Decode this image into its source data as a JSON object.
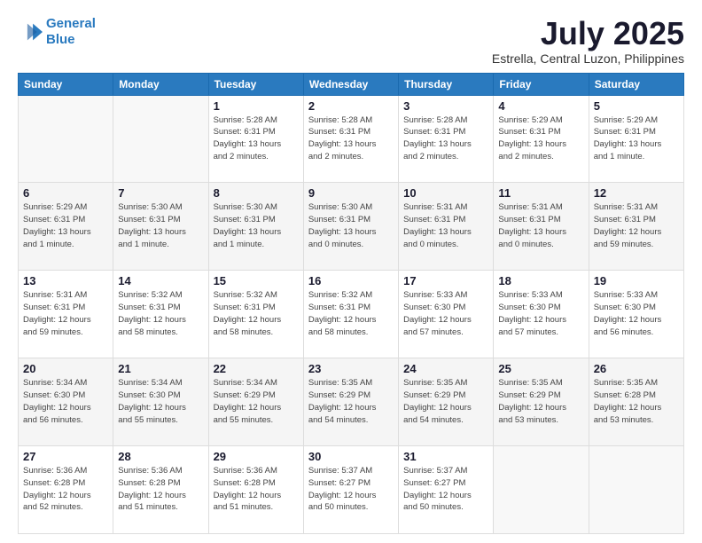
{
  "logo": {
    "line1": "General",
    "line2": "Blue"
  },
  "title": "July 2025",
  "subtitle": "Estrella, Central Luzon, Philippines",
  "weekdays": [
    "Sunday",
    "Monday",
    "Tuesday",
    "Wednesday",
    "Thursday",
    "Friday",
    "Saturday"
  ],
  "weeks": [
    [
      {
        "day": "",
        "info": ""
      },
      {
        "day": "",
        "info": ""
      },
      {
        "day": "1",
        "info": "Sunrise: 5:28 AM\nSunset: 6:31 PM\nDaylight: 13 hours\nand 2 minutes."
      },
      {
        "day": "2",
        "info": "Sunrise: 5:28 AM\nSunset: 6:31 PM\nDaylight: 13 hours\nand 2 minutes."
      },
      {
        "day": "3",
        "info": "Sunrise: 5:28 AM\nSunset: 6:31 PM\nDaylight: 13 hours\nand 2 minutes."
      },
      {
        "day": "4",
        "info": "Sunrise: 5:29 AM\nSunset: 6:31 PM\nDaylight: 13 hours\nand 2 minutes."
      },
      {
        "day": "5",
        "info": "Sunrise: 5:29 AM\nSunset: 6:31 PM\nDaylight: 13 hours\nand 1 minute."
      }
    ],
    [
      {
        "day": "6",
        "info": "Sunrise: 5:29 AM\nSunset: 6:31 PM\nDaylight: 13 hours\nand 1 minute."
      },
      {
        "day": "7",
        "info": "Sunrise: 5:30 AM\nSunset: 6:31 PM\nDaylight: 13 hours\nand 1 minute."
      },
      {
        "day": "8",
        "info": "Sunrise: 5:30 AM\nSunset: 6:31 PM\nDaylight: 13 hours\nand 1 minute."
      },
      {
        "day": "9",
        "info": "Sunrise: 5:30 AM\nSunset: 6:31 PM\nDaylight: 13 hours\nand 0 minutes."
      },
      {
        "day": "10",
        "info": "Sunrise: 5:31 AM\nSunset: 6:31 PM\nDaylight: 13 hours\nand 0 minutes."
      },
      {
        "day": "11",
        "info": "Sunrise: 5:31 AM\nSunset: 6:31 PM\nDaylight: 13 hours\nand 0 minutes."
      },
      {
        "day": "12",
        "info": "Sunrise: 5:31 AM\nSunset: 6:31 PM\nDaylight: 12 hours\nand 59 minutes."
      }
    ],
    [
      {
        "day": "13",
        "info": "Sunrise: 5:31 AM\nSunset: 6:31 PM\nDaylight: 12 hours\nand 59 minutes."
      },
      {
        "day": "14",
        "info": "Sunrise: 5:32 AM\nSunset: 6:31 PM\nDaylight: 12 hours\nand 58 minutes."
      },
      {
        "day": "15",
        "info": "Sunrise: 5:32 AM\nSunset: 6:31 PM\nDaylight: 12 hours\nand 58 minutes."
      },
      {
        "day": "16",
        "info": "Sunrise: 5:32 AM\nSunset: 6:31 PM\nDaylight: 12 hours\nand 58 minutes."
      },
      {
        "day": "17",
        "info": "Sunrise: 5:33 AM\nSunset: 6:30 PM\nDaylight: 12 hours\nand 57 minutes."
      },
      {
        "day": "18",
        "info": "Sunrise: 5:33 AM\nSunset: 6:30 PM\nDaylight: 12 hours\nand 57 minutes."
      },
      {
        "day": "19",
        "info": "Sunrise: 5:33 AM\nSunset: 6:30 PM\nDaylight: 12 hours\nand 56 minutes."
      }
    ],
    [
      {
        "day": "20",
        "info": "Sunrise: 5:34 AM\nSunset: 6:30 PM\nDaylight: 12 hours\nand 56 minutes."
      },
      {
        "day": "21",
        "info": "Sunrise: 5:34 AM\nSunset: 6:30 PM\nDaylight: 12 hours\nand 55 minutes."
      },
      {
        "day": "22",
        "info": "Sunrise: 5:34 AM\nSunset: 6:29 PM\nDaylight: 12 hours\nand 55 minutes."
      },
      {
        "day": "23",
        "info": "Sunrise: 5:35 AM\nSunset: 6:29 PM\nDaylight: 12 hours\nand 54 minutes."
      },
      {
        "day": "24",
        "info": "Sunrise: 5:35 AM\nSunset: 6:29 PM\nDaylight: 12 hours\nand 54 minutes."
      },
      {
        "day": "25",
        "info": "Sunrise: 5:35 AM\nSunset: 6:29 PM\nDaylight: 12 hours\nand 53 minutes."
      },
      {
        "day": "26",
        "info": "Sunrise: 5:35 AM\nSunset: 6:28 PM\nDaylight: 12 hours\nand 53 minutes."
      }
    ],
    [
      {
        "day": "27",
        "info": "Sunrise: 5:36 AM\nSunset: 6:28 PM\nDaylight: 12 hours\nand 52 minutes."
      },
      {
        "day": "28",
        "info": "Sunrise: 5:36 AM\nSunset: 6:28 PM\nDaylight: 12 hours\nand 51 minutes."
      },
      {
        "day": "29",
        "info": "Sunrise: 5:36 AM\nSunset: 6:28 PM\nDaylight: 12 hours\nand 51 minutes."
      },
      {
        "day": "30",
        "info": "Sunrise: 5:37 AM\nSunset: 6:27 PM\nDaylight: 12 hours\nand 50 minutes."
      },
      {
        "day": "31",
        "info": "Sunrise: 5:37 AM\nSunset: 6:27 PM\nDaylight: 12 hours\nand 50 minutes."
      },
      {
        "day": "",
        "info": ""
      },
      {
        "day": "",
        "info": ""
      }
    ]
  ],
  "colors": {
    "header_bg": "#2a7abf",
    "header_text": "#ffffff",
    "title_color": "#1a1a2e"
  }
}
